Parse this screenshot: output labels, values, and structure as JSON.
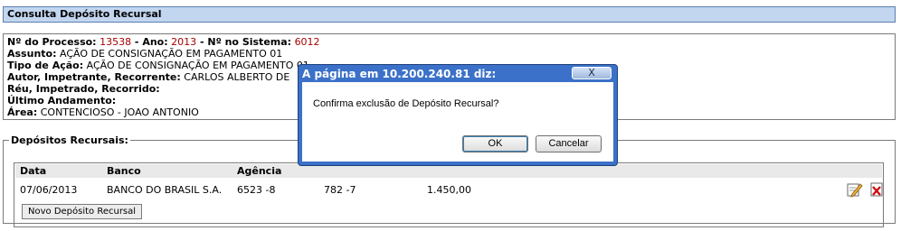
{
  "page": {
    "title": "Consulta Depósito Recursal"
  },
  "process_info": {
    "processo_label": "Nº do Processo:",
    "processo_value": "13538",
    "ano_label": "Ano:",
    "ano_value": "2013",
    "sistema_label": "Nº no Sistema:",
    "sistema_value": "6012",
    "sep": " - ",
    "assunto_label": "Assunto:",
    "assunto_value": "AÇÃO DE CONSIGNAÇÃO EM PAGAMENTO 01",
    "tipo_label": "Tipo de Ação:",
    "tipo_value": "AÇÃO DE CONSIGNAÇÃO EM PAGAMENTO 01",
    "autor_label": "Autor, Impetrante, Recorrente:",
    "autor_value": "CARLOS ALBERTO DE",
    "reu_label": "Réu, Impetrado, Recorrido:",
    "ultimo_label": "Último Andamento:",
    "area_label": "Área:",
    "area_value": "CONTENCIOSO - JOAO ANTONIO"
  },
  "depositos": {
    "legend": "Depósitos Recursais:",
    "columns": [
      "Data",
      "Banco",
      "Agência"
    ],
    "rows": [
      {
        "data": "07/06/2013",
        "banco": "BANCO DO BRASIL S.A.",
        "agencia": "6523 -8",
        "conta": "782 -7",
        "valor": "1.450,00"
      }
    ],
    "novo_button": "Novo Depósito  Recursal"
  },
  "dialog": {
    "title": "A página em 10.200.240.81 diz:",
    "close": "X",
    "message": "Confirma exclusão de Depósito Recursal?",
    "ok": "OK",
    "cancel": "Cancelar"
  },
  "icons": {
    "edit": "edit-icon",
    "delete": "delete-icon"
  },
  "colors": {
    "title_bar_bg": "#c3d6ef",
    "value_red": "#a80000",
    "dialog_frame": "#3b71c8"
  }
}
